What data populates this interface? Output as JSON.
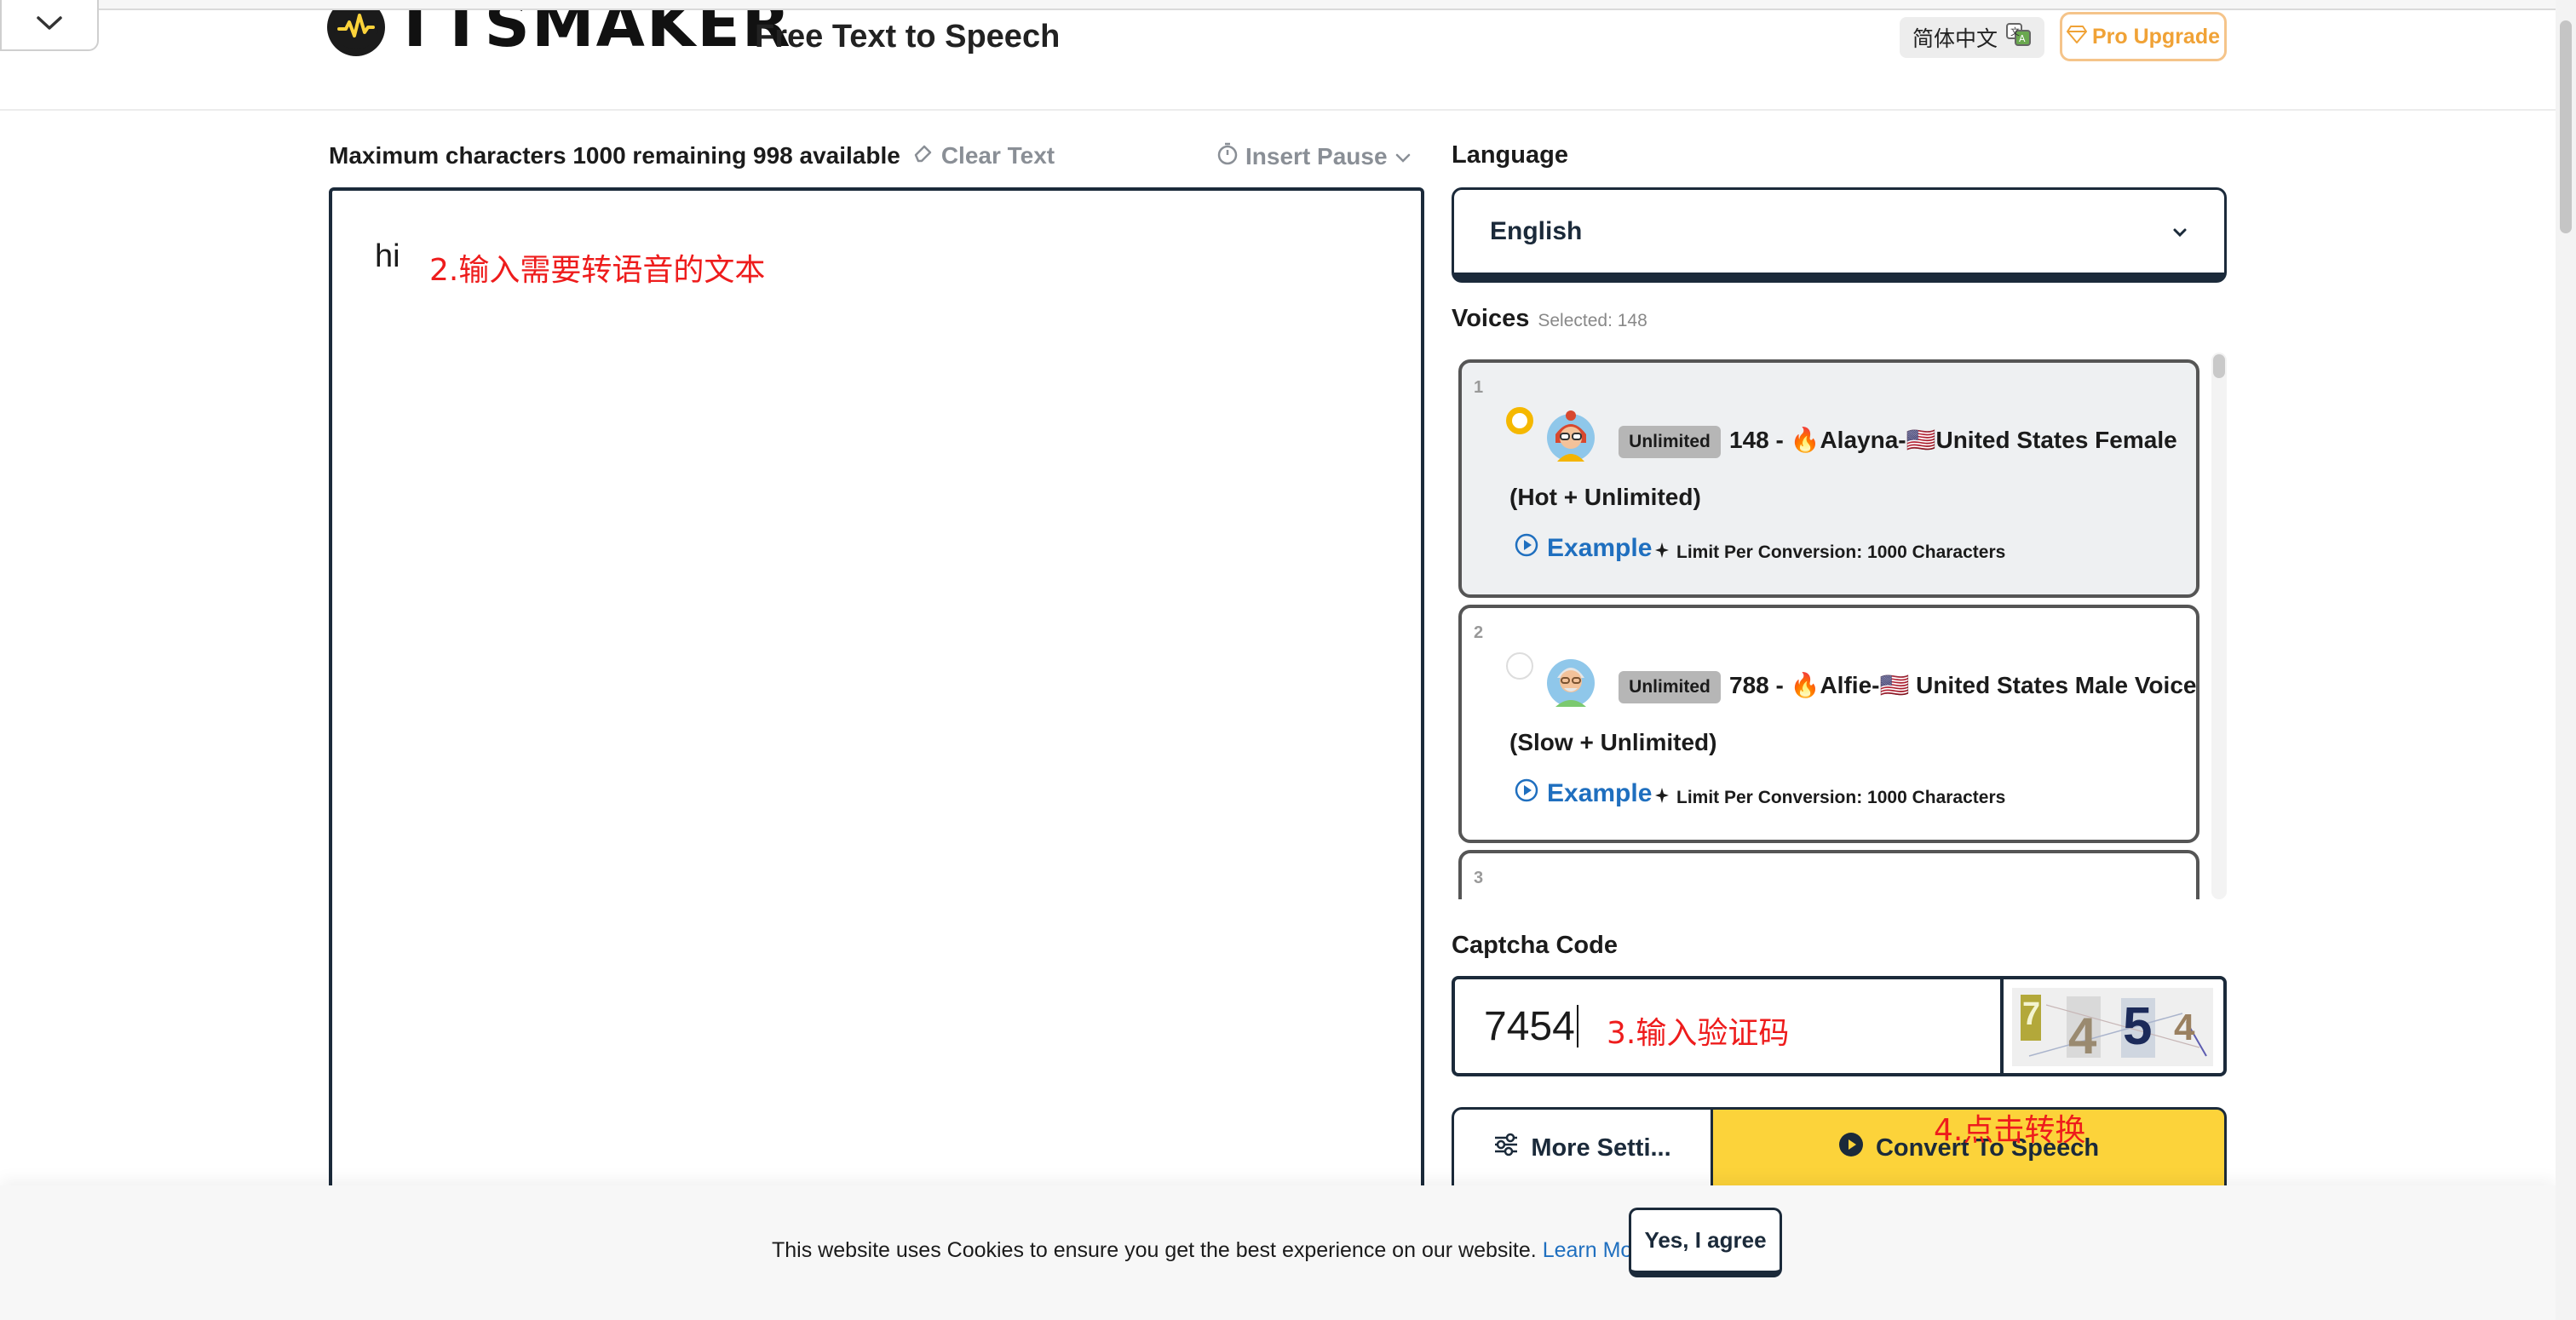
{
  "header": {
    "logo_text": "TTSMAKER",
    "tagline": "Free Text to Speech",
    "language_button": "简体中文",
    "pro_button": "Pro Upgrade"
  },
  "editor": {
    "char_info": "Maximum characters 1000 remaining 998 available",
    "clear_text": "Clear Text",
    "insert_pause": "Insert Pause",
    "text_value": "hi",
    "annotation": "2.输入需要转语音的文本"
  },
  "language": {
    "label": "Language",
    "selected": "English"
  },
  "voices": {
    "label": "Voices",
    "selected_info": "Selected: 148",
    "items": [
      {
        "index": "1",
        "badge": "Unlimited",
        "name_line1": "148 - 🔥Alayna-🇺🇸United States Female",
        "name_line2": "(Hot + Unlimited)",
        "example": "Example",
        "limit": "Limit Per Conversion: 1000 Characters",
        "selected": true
      },
      {
        "index": "2",
        "badge": "Unlimited",
        "name_line1": "788 - 🔥Alfie-🇺🇸 United States Male Voice",
        "name_line2": "(Slow + Unlimited)",
        "example": "Example",
        "limit": "Limit Per Conversion: 1000 Characters",
        "selected": false
      },
      {
        "index": "3"
      }
    ]
  },
  "captcha": {
    "label": "Captcha Code",
    "value": "7454",
    "annotation": "3.输入验证码",
    "image_chars": [
      "7",
      "4",
      "5",
      "4"
    ]
  },
  "actions": {
    "more_settings": "More Setti...",
    "convert": "Convert To Speech",
    "annotation": "4.点击转换"
  },
  "cookie": {
    "text": "This website uses Cookies to ensure you get the best experience on our website.",
    "learn_more": "Learn More",
    "agree": "Yes, I agree"
  },
  "colors": {
    "accent_yellow": "#fcd33a",
    "dark_navy": "#1b2a3a",
    "link_blue": "#1f6fbf",
    "annotation_red": "#ee1c1c",
    "pro_orange": "#f0a236"
  }
}
